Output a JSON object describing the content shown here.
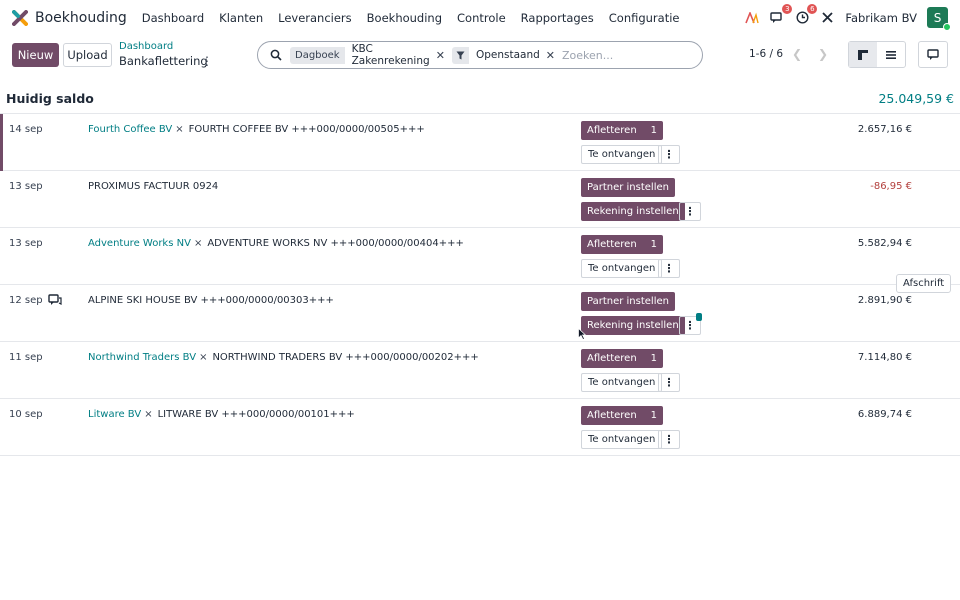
{
  "navbar": {
    "app_name": "Boekhouding",
    "menu": [
      "Dashboard",
      "Klanten",
      "Leveranciers",
      "Boekhouding",
      "Controle",
      "Rapportages",
      "Configuratie"
    ],
    "messages_count": "3",
    "activities_count": "6",
    "company": "Fabrikam BV",
    "avatar_letter": "S"
  },
  "control": {
    "new_label": "Nieuw",
    "upload_label": "Upload",
    "breadcrumb_parent": "Dashboard",
    "breadcrumb_current": "Bankaflettering",
    "gear_glyph": "⋮"
  },
  "search": {
    "facets": [
      {
        "label": "Dagboek",
        "value": "KBC Zakenrekening"
      },
      {
        "icon": "filter-icon",
        "value": "Openstaand"
      }
    ],
    "placeholder": "Zoeken..."
  },
  "pager": {
    "value": "1-6 / 6"
  },
  "balance": {
    "label": "Huidig saldo",
    "value": "25.049,59 €"
  },
  "rows": [
    {
      "date": "14 sep",
      "partner": "Fourth Coffee BV",
      "ref": "FOURTH COFFEE BV +++000/0000/00505+++",
      "amount": "2.657,16 €",
      "actions": [
        "Afletteren",
        "Te ontvangen"
      ],
      "count": "1"
    },
    {
      "date": "13 sep",
      "partner": "",
      "ref": "PROXIMUS FACTUUR 0924",
      "amount": "-86,95 €",
      "actions": [
        "Partner instellen",
        "Rekening instellen"
      ]
    },
    {
      "date": "13 sep",
      "partner": "Adventure Works NV",
      "ref": "ADVENTURE WORKS NV +++000/0000/00404+++",
      "amount": "5.582,94 €",
      "actions": [
        "Afletteren",
        "Te ontvangen"
      ],
      "count": "1"
    },
    {
      "date": "12 sep",
      "partner": "",
      "ref": "ALPINE SKI HOUSE BV +++000/0000/00303+++",
      "amount": "2.891,90 €",
      "actions": [
        "Partner instellen",
        "Rekening instellen"
      ]
    },
    {
      "date": "11 sep",
      "partner": "Northwind Traders BV",
      "ref": "NORTHWIND TRADERS BV +++000/0000/00202+++",
      "amount": "7.114,80 €",
      "actions": [
        "Afletteren",
        "Te ontvangen"
      ],
      "count": "1"
    },
    {
      "date": "10 sep",
      "partner": "Litware BV",
      "ref": "LITWARE BV +++000/0000/00101+++",
      "amount": "6.889,74 €",
      "actions": [
        "Afletteren",
        "Te ontvangen"
      ],
      "count": "1"
    }
  ],
  "tooltip": "Afschrift",
  "colors": {
    "brand": "#714b67",
    "accent": "#017e84",
    "negative": "#b3403d"
  }
}
